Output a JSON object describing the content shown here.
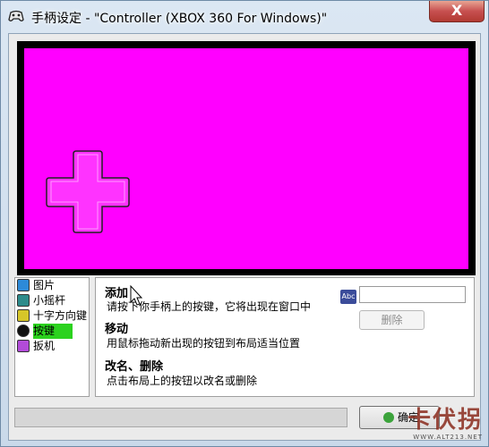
{
  "window": {
    "title": "手柄设定 - \"Controller (XBOX 360 For Windows)\"",
    "close_label": "X"
  },
  "layout_list": {
    "items": [
      {
        "label": "图片",
        "icon": "picture-icon",
        "color": "#2d8ad8"
      },
      {
        "label": "小摇杆",
        "icon": "thumbstick-icon",
        "color": "#2d8b8b"
      },
      {
        "label": "十字方向键",
        "icon": "dpad-icon",
        "color": "#d6c629"
      },
      {
        "label": "按键",
        "icon": "button-icon",
        "color": "#111111",
        "selected": true
      },
      {
        "label": "扳机",
        "icon": "trigger-icon",
        "color": "#b24bd8"
      }
    ]
  },
  "help": {
    "add_title": "添加",
    "add_desc": "请按下你手柄上的按键，它将出现在窗口中",
    "move_title": "移动",
    "move_desc": "用鼠标拖动新出现的按钮到布局适当位置",
    "rename_title": "改名、删除",
    "rename_desc": "点击布局上的按钮以改名或删除"
  },
  "editor": {
    "abc_label": "Abc",
    "name_value": "",
    "delete_label": "删除"
  },
  "footer": {
    "ok_label": "确定"
  },
  "watermark": {
    "text": "卡伏拐",
    "url": "WWW.ALT213.NET"
  },
  "colors": {
    "canvas": "#ff00ff",
    "dpad": "#ff33ff",
    "selection": "#2bd21e"
  }
}
